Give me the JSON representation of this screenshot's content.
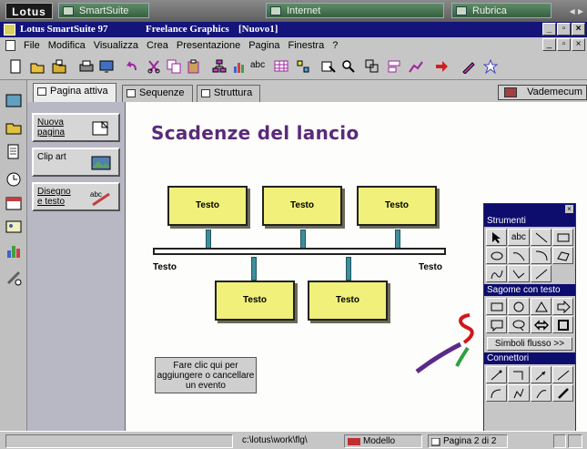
{
  "smartcenter": {
    "logo": "Lotus",
    "drawers": [
      "SmartSuite",
      "Internet",
      "Rubrica"
    ]
  },
  "app_titlebar": {
    "app_name": "Lotus SmartSuite 97",
    "product": "Freelance Graphics",
    "document": "[Nuovo1]"
  },
  "menubar": {
    "items": [
      "File",
      "Modifica",
      "Visualizza",
      "Crea",
      "Presentazione",
      "Pagina",
      "Finestra",
      "?"
    ]
  },
  "tabs": [
    "Pagina attiva",
    "Sequenze",
    "Struttura"
  ],
  "vademecum_label": "Vademecum",
  "side_panel": {
    "buttons": [
      {
        "label": "Nuova pagina"
      },
      {
        "label": "Clip art"
      },
      {
        "label": "Disegno e testo"
      }
    ]
  },
  "canvas": {
    "title": "Scadenze del lancio",
    "top_boxes": [
      "Testo",
      "Testo",
      "Testo"
    ],
    "bottom_boxes": [
      "Testo",
      "Testo"
    ],
    "timeline_left_label": "Testo",
    "timeline_right_label": "Testo",
    "hint": "Fare clic qui per aggiungere o cancellare un evento"
  },
  "palette": {
    "section_tools": "Strumenti",
    "text_tool": "abc",
    "section_shapes": "Sagome con testo",
    "flow_button": "Simboli flusso >>",
    "section_connectors": "Connettori"
  },
  "statusbar": {
    "path": "c:\\lotus\\work\\flg\\",
    "template": "Modello pagina...",
    "page_indicator": "Pagina 2 di 2"
  },
  "colors": {
    "title_purple": "#5a2a7a",
    "box_yellow": "#f0f07a",
    "connector_teal": "#3d8e9a",
    "titlebar_navy": "#14147a"
  }
}
